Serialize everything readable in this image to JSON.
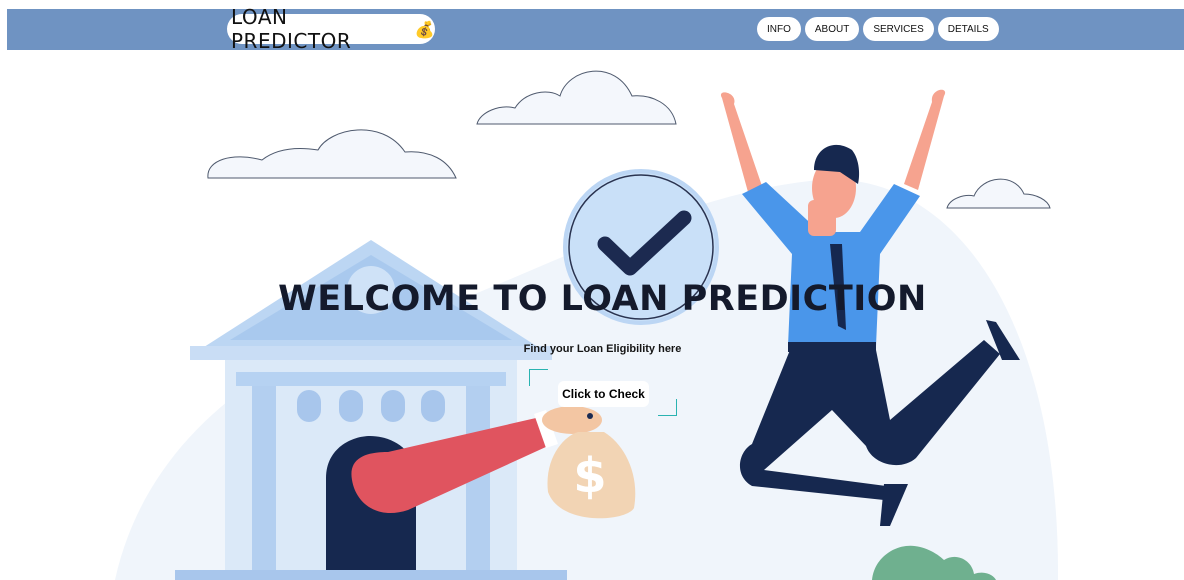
{
  "brand": {
    "title": "LOAN PREDICTOR",
    "icon": "money-bag-icon"
  },
  "nav": {
    "items": [
      "INFO",
      "ABOUT",
      "SERVICES",
      "DETAILS"
    ]
  },
  "hero": {
    "headline": "WELCOME TO LOAN PREDICTION",
    "subtitle": "Find your Loan Eligibility here",
    "cta_label": "Click to Check"
  },
  "colors": {
    "navbar": "#6f93c2",
    "accent_teal": "#2ab3b1",
    "bank": "#c7dcf3",
    "navy": "#1a2a52",
    "red_sleeve": "#e0545f",
    "shirt": "#4a96ea"
  }
}
